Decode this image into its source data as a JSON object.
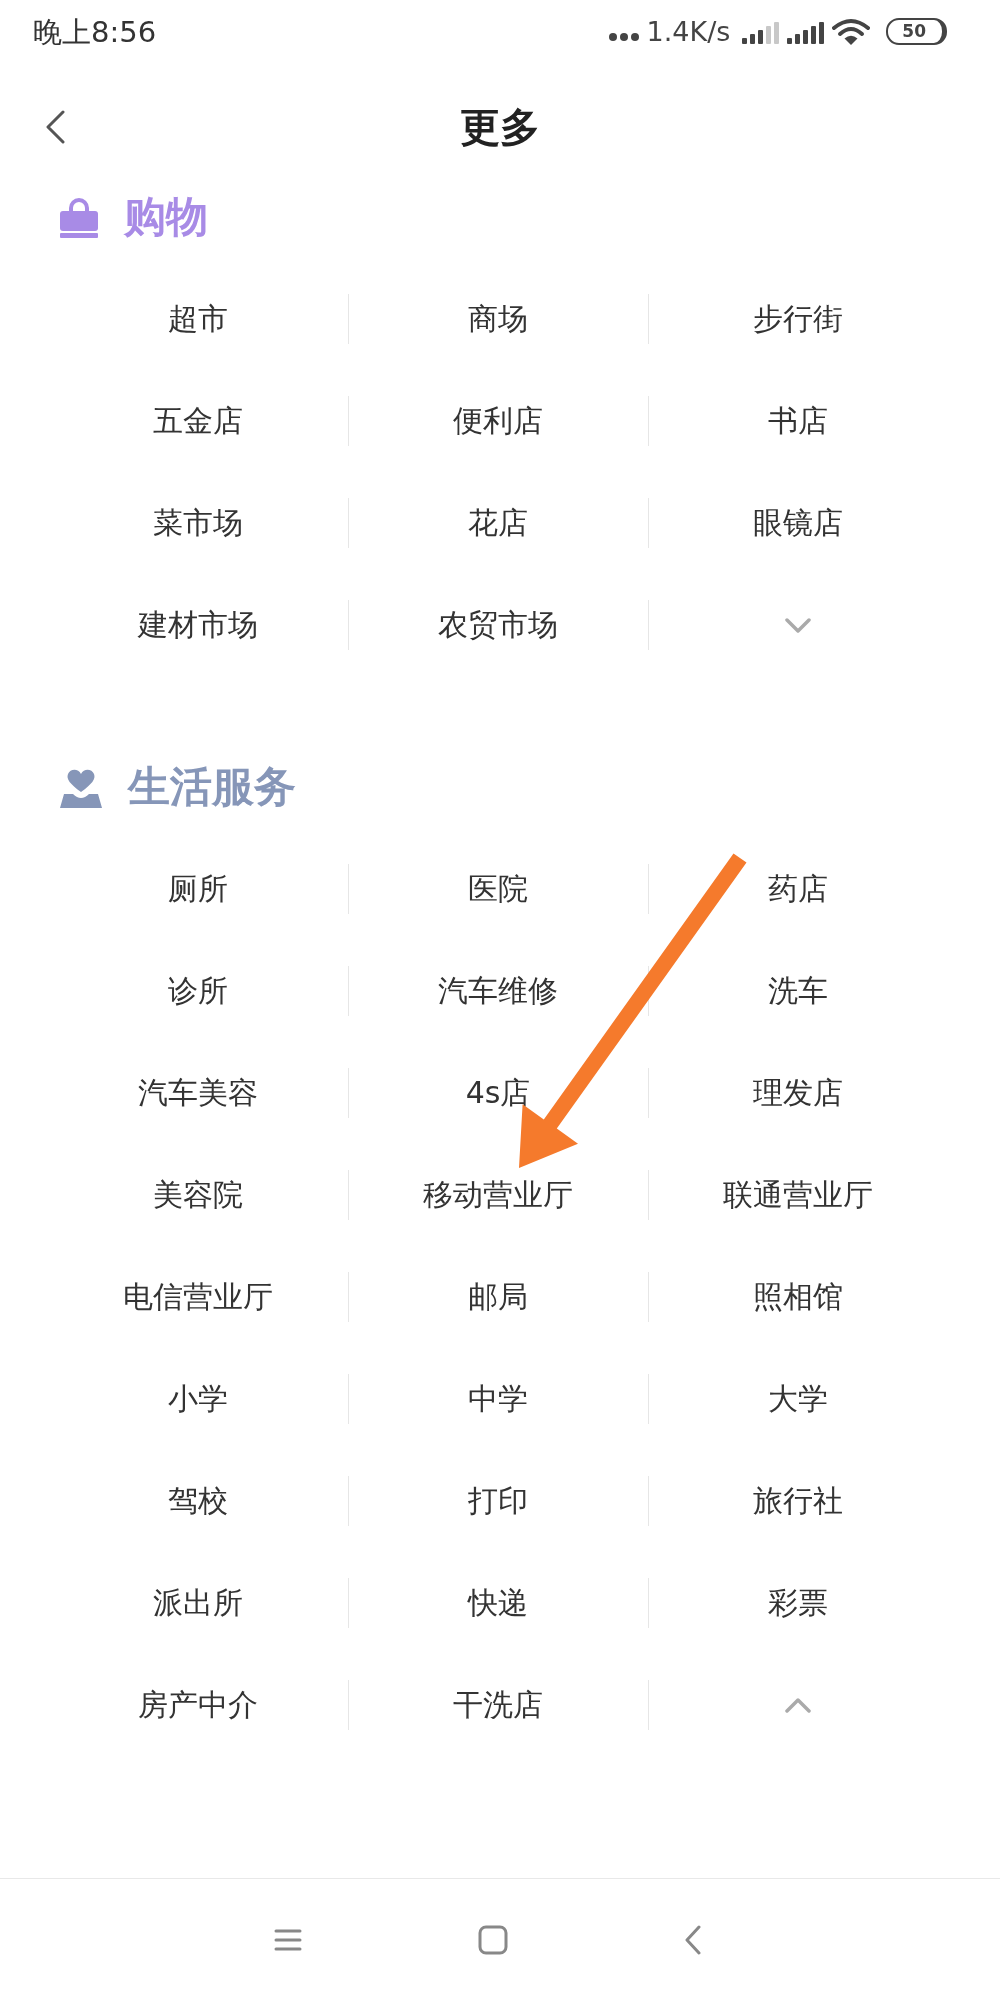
{
  "status_bar": {
    "time": "晚上8:56",
    "network_speed": "1.4K/s",
    "battery": "50"
  },
  "header": {
    "title": "更多"
  },
  "sections": [
    {
      "kind": "shopping",
      "title": "购物",
      "color": "#a88be6",
      "expanded": false,
      "items": [
        "超市",
        "商场",
        "步行街",
        "五金店",
        "便利店",
        "书店",
        "菜市场",
        "花店",
        "眼镜店",
        "建材市场",
        "农贸市场"
      ]
    },
    {
      "kind": "services",
      "title": "生活服务",
      "color": "#8696b8",
      "expanded": true,
      "items": [
        "厕所",
        "医院",
        "药店",
        "诊所",
        "汽车维修",
        "洗车",
        "汽车美容",
        "4s店",
        "理发店",
        "美容院",
        "移动营业厅",
        "联通营业厅",
        "电信营业厅",
        "邮局",
        "照相馆",
        "小学",
        "中学",
        "大学",
        "驾校",
        "打印",
        "旅行社",
        "派出所",
        "快递",
        "彩票",
        "房产中介",
        "干洗店"
      ]
    }
  ]
}
